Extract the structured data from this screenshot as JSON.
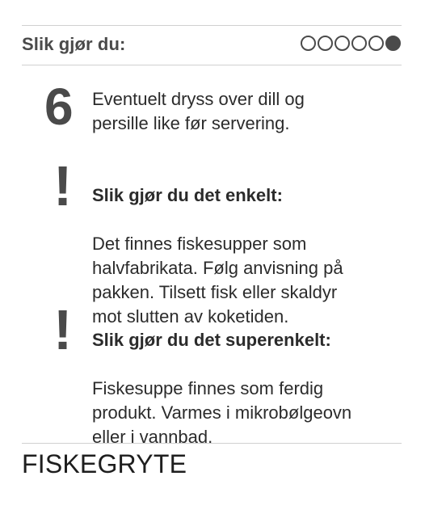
{
  "header": {
    "title": "Slik gjør du:",
    "progress": {
      "total": 6,
      "current": 6
    }
  },
  "step": {
    "number": "6",
    "text": "Eventuelt dryss over dill og\npersille like før servering."
  },
  "tips": [
    {
      "icon": "!",
      "title": "Slik gjør du det enkelt:",
      "text": "Det finnes fiskesupper som\nhalvfabrikata. Følg anvisning på\npakken. Tilsett fisk eller skaldyr\nmot slutten av koketiden."
    },
    {
      "icon": "!",
      "title": "Slik gjør du det superenkelt:",
      "text": "Fiskesuppe finnes som ferdig\nprodukt. Varmes i mikrobølgeovn\neller i vannbad."
    }
  ],
  "footer": {
    "title": "FISKEGRYTE"
  },
  "colors": {
    "heading": "#4a4a4a",
    "text": "#2b2b2b",
    "rule": "#d0d0d0"
  }
}
